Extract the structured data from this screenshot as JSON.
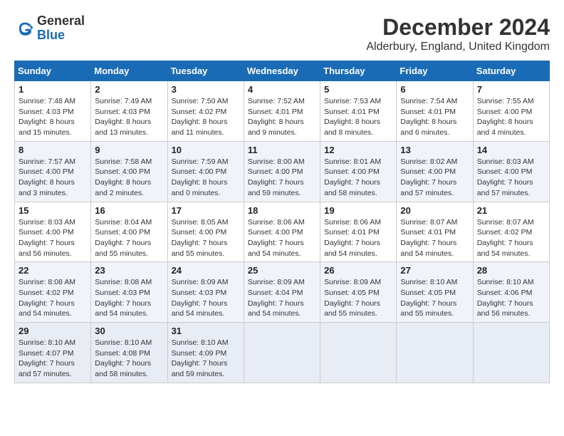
{
  "logo": {
    "general": "General",
    "blue": "Blue"
  },
  "title": "December 2024",
  "subtitle": "Alderbury, England, United Kingdom",
  "weekdays": [
    "Sunday",
    "Monday",
    "Tuesday",
    "Wednesday",
    "Thursday",
    "Friday",
    "Saturday"
  ],
  "weeks": [
    [
      {
        "day": "1",
        "sunrise": "Sunrise: 7:48 AM",
        "sunset": "Sunset: 4:03 PM",
        "daylight": "Daylight: 8 hours and 15 minutes."
      },
      {
        "day": "2",
        "sunrise": "Sunrise: 7:49 AM",
        "sunset": "Sunset: 4:03 PM",
        "daylight": "Daylight: 8 hours and 13 minutes."
      },
      {
        "day": "3",
        "sunrise": "Sunrise: 7:50 AM",
        "sunset": "Sunset: 4:02 PM",
        "daylight": "Daylight: 8 hours and 11 minutes."
      },
      {
        "day": "4",
        "sunrise": "Sunrise: 7:52 AM",
        "sunset": "Sunset: 4:01 PM",
        "daylight": "Daylight: 8 hours and 9 minutes."
      },
      {
        "day": "5",
        "sunrise": "Sunrise: 7:53 AM",
        "sunset": "Sunset: 4:01 PM",
        "daylight": "Daylight: 8 hours and 8 minutes."
      },
      {
        "day": "6",
        "sunrise": "Sunrise: 7:54 AM",
        "sunset": "Sunset: 4:01 PM",
        "daylight": "Daylight: 8 hours and 6 minutes."
      },
      {
        "day": "7",
        "sunrise": "Sunrise: 7:55 AM",
        "sunset": "Sunset: 4:00 PM",
        "daylight": "Daylight: 8 hours and 4 minutes."
      }
    ],
    [
      {
        "day": "8",
        "sunrise": "Sunrise: 7:57 AM",
        "sunset": "Sunset: 4:00 PM",
        "daylight": "Daylight: 8 hours and 3 minutes."
      },
      {
        "day": "9",
        "sunrise": "Sunrise: 7:58 AM",
        "sunset": "Sunset: 4:00 PM",
        "daylight": "Daylight: 8 hours and 2 minutes."
      },
      {
        "day": "10",
        "sunrise": "Sunrise: 7:59 AM",
        "sunset": "Sunset: 4:00 PM",
        "daylight": "Daylight: 8 hours and 0 minutes."
      },
      {
        "day": "11",
        "sunrise": "Sunrise: 8:00 AM",
        "sunset": "Sunset: 4:00 PM",
        "daylight": "Daylight: 7 hours and 59 minutes."
      },
      {
        "day": "12",
        "sunrise": "Sunrise: 8:01 AM",
        "sunset": "Sunset: 4:00 PM",
        "daylight": "Daylight: 7 hours and 58 minutes."
      },
      {
        "day": "13",
        "sunrise": "Sunrise: 8:02 AM",
        "sunset": "Sunset: 4:00 PM",
        "daylight": "Daylight: 7 hours and 57 minutes."
      },
      {
        "day": "14",
        "sunrise": "Sunrise: 8:03 AM",
        "sunset": "Sunset: 4:00 PM",
        "daylight": "Daylight: 7 hours and 57 minutes."
      }
    ],
    [
      {
        "day": "15",
        "sunrise": "Sunrise: 8:03 AM",
        "sunset": "Sunset: 4:00 PM",
        "daylight": "Daylight: 7 hours and 56 minutes."
      },
      {
        "day": "16",
        "sunrise": "Sunrise: 8:04 AM",
        "sunset": "Sunset: 4:00 PM",
        "daylight": "Daylight: 7 hours and 55 minutes."
      },
      {
        "day": "17",
        "sunrise": "Sunrise: 8:05 AM",
        "sunset": "Sunset: 4:00 PM",
        "daylight": "Daylight: 7 hours and 55 minutes."
      },
      {
        "day": "18",
        "sunrise": "Sunrise: 8:06 AM",
        "sunset": "Sunset: 4:00 PM",
        "daylight": "Daylight: 7 hours and 54 minutes."
      },
      {
        "day": "19",
        "sunrise": "Sunrise: 8:06 AM",
        "sunset": "Sunset: 4:01 PM",
        "daylight": "Daylight: 7 hours and 54 minutes."
      },
      {
        "day": "20",
        "sunrise": "Sunrise: 8:07 AM",
        "sunset": "Sunset: 4:01 PM",
        "daylight": "Daylight: 7 hours and 54 minutes."
      },
      {
        "day": "21",
        "sunrise": "Sunrise: 8:07 AM",
        "sunset": "Sunset: 4:02 PM",
        "daylight": "Daylight: 7 hours and 54 minutes."
      }
    ],
    [
      {
        "day": "22",
        "sunrise": "Sunrise: 8:08 AM",
        "sunset": "Sunset: 4:02 PM",
        "daylight": "Daylight: 7 hours and 54 minutes."
      },
      {
        "day": "23",
        "sunrise": "Sunrise: 8:08 AM",
        "sunset": "Sunset: 4:03 PM",
        "daylight": "Daylight: 7 hours and 54 minutes."
      },
      {
        "day": "24",
        "sunrise": "Sunrise: 8:09 AM",
        "sunset": "Sunset: 4:03 PM",
        "daylight": "Daylight: 7 hours and 54 minutes."
      },
      {
        "day": "25",
        "sunrise": "Sunrise: 8:09 AM",
        "sunset": "Sunset: 4:04 PM",
        "daylight": "Daylight: 7 hours and 54 minutes."
      },
      {
        "day": "26",
        "sunrise": "Sunrise: 8:09 AM",
        "sunset": "Sunset: 4:05 PM",
        "daylight": "Daylight: 7 hours and 55 minutes."
      },
      {
        "day": "27",
        "sunrise": "Sunrise: 8:10 AM",
        "sunset": "Sunset: 4:05 PM",
        "daylight": "Daylight: 7 hours and 55 minutes."
      },
      {
        "day": "28",
        "sunrise": "Sunrise: 8:10 AM",
        "sunset": "Sunset: 4:06 PM",
        "daylight": "Daylight: 7 hours and 56 minutes."
      }
    ],
    [
      {
        "day": "29",
        "sunrise": "Sunrise: 8:10 AM",
        "sunset": "Sunset: 4:07 PM",
        "daylight": "Daylight: 7 hours and 57 minutes."
      },
      {
        "day": "30",
        "sunrise": "Sunrise: 8:10 AM",
        "sunset": "Sunset: 4:08 PM",
        "daylight": "Daylight: 7 hours and 58 minutes."
      },
      {
        "day": "31",
        "sunrise": "Sunrise: 8:10 AM",
        "sunset": "Sunset: 4:09 PM",
        "daylight": "Daylight: 7 hours and 59 minutes."
      },
      null,
      null,
      null,
      null
    ]
  ]
}
